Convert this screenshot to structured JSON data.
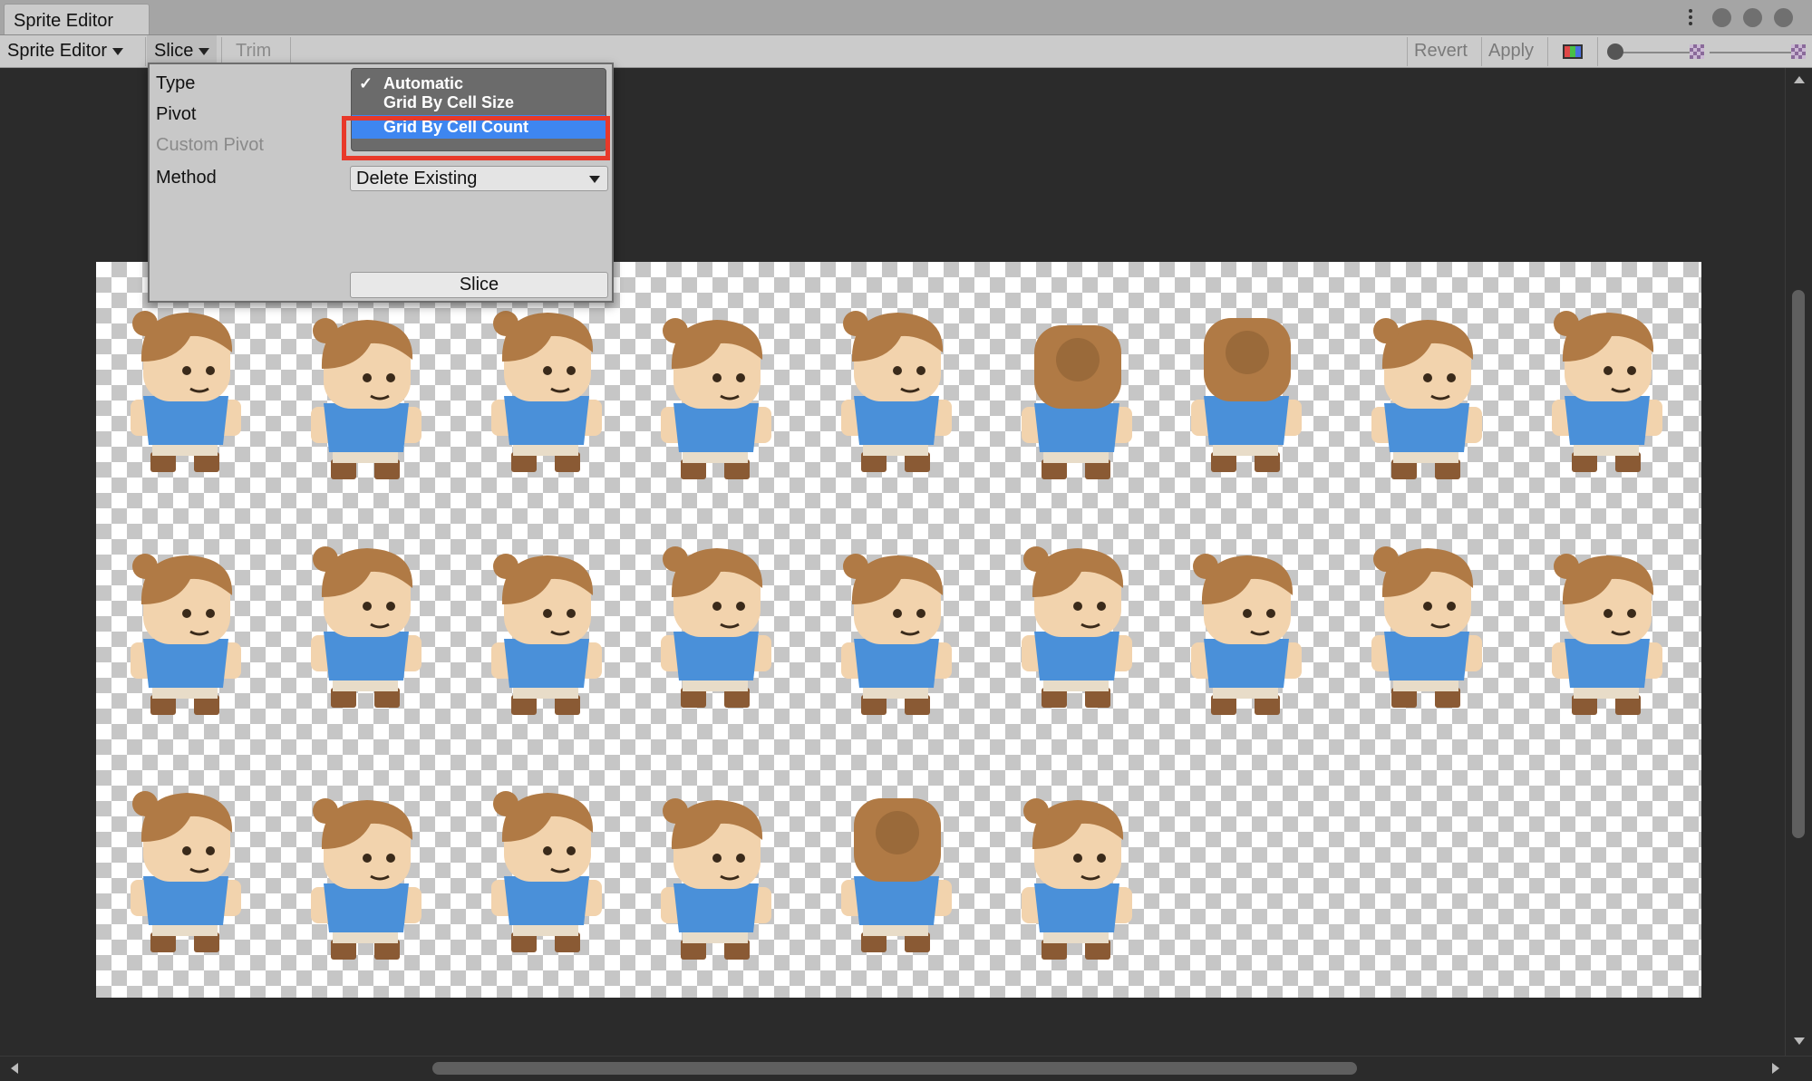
{
  "window": {
    "tab_title": "Sprite Editor"
  },
  "toolbar": {
    "mode_dropdown": "Sprite Editor",
    "slice_label": "Slice",
    "trim_label": "Trim",
    "revert_label": "Revert",
    "apply_label": "Apply"
  },
  "slice_popup": {
    "type_label": "Type",
    "pivot_label": "Pivot",
    "custom_pivot_label": "Custom Pivot",
    "method_label": "Method",
    "method_value": "Delete Existing",
    "slice_button": "Slice",
    "type_options": [
      {
        "label": "Automatic",
        "checked": true
      },
      {
        "label": "Grid By Cell Size",
        "checked": false
      },
      {
        "label": "Grid By Cell Count",
        "checked": false,
        "hovered": true
      }
    ],
    "check_mark": "✓"
  },
  "colors": {
    "hover_highlight": "#3e86f0",
    "annotation_box": "#e8392a",
    "shirt": "#4a90d9",
    "hair": "#b07a45",
    "skin": "#f2d3ad",
    "boots": "#8a5a34"
  },
  "sprites": {
    "rows": [
      9,
      9,
      6
    ],
    "total": 24
  }
}
